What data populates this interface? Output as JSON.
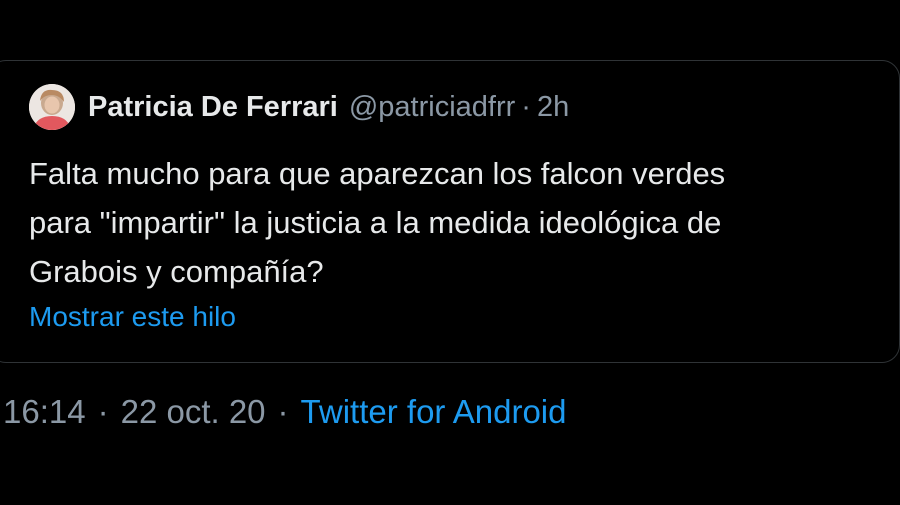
{
  "quoted_tweet": {
    "author": {
      "name": "Patricia De Ferrari",
      "handle": "@patriciadfrr",
      "avatar_icon": "profile-photo-icon"
    },
    "separator": "·",
    "age": "2h",
    "text_lines": [
      "Falta mucho para que aparezcan los falcon verdes",
      "para \"impartir\" la justicia a la medida ideológica de",
      "Grabois y compañía?"
    ],
    "show_thread_label": "Mostrar este hilo"
  },
  "tweet_meta": {
    "time": "16:14",
    "separator": "·",
    "date": "22 oct. 20",
    "source": "Twitter for Android"
  },
  "colors": {
    "background": "#000000",
    "primary_text": "#e7e9ea",
    "secondary_text": "#8b98a5",
    "link": "#1d9bf0",
    "border": "#2f3336"
  }
}
